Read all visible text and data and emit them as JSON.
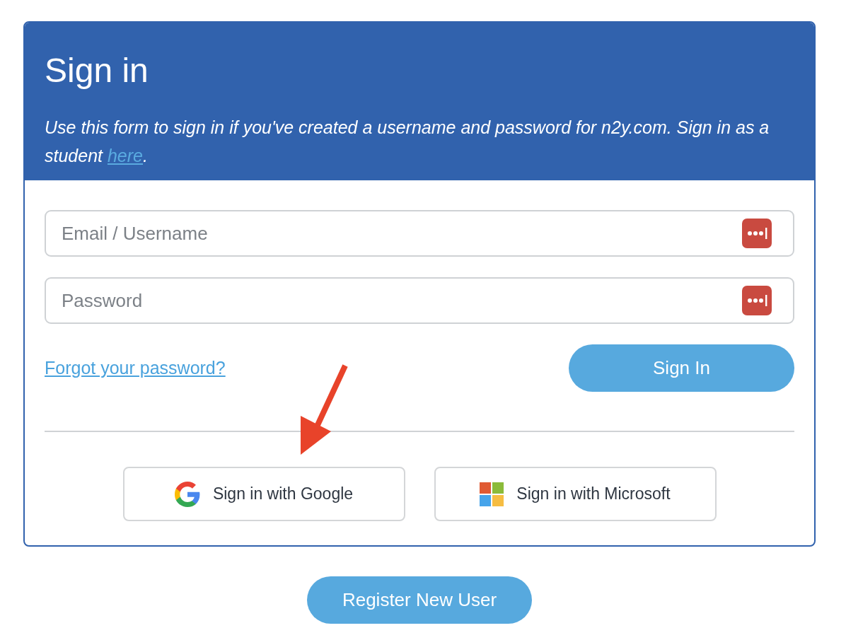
{
  "header": {
    "title": "Sign in",
    "intro": {
      "text": "Use this form to sign in if you've created a username and password for n2y.com. Sign in as a student",
      "link": "here",
      "after_link": "."
    }
  },
  "fields": [
    {
      "placeholder": "Email / Username"
    },
    {
      "placeholder": "Password"
    }
  ],
  "forgot_link": "Forgot your password?",
  "sign_in_button": "Sign In",
  "social_buttons": [
    {
      "kind": "google",
      "label": "Sign in with Google"
    },
    {
      "kind": "microsoft",
      "label": "Sign in with Microsoft"
    }
  ],
  "register_button": "Register New User"
}
